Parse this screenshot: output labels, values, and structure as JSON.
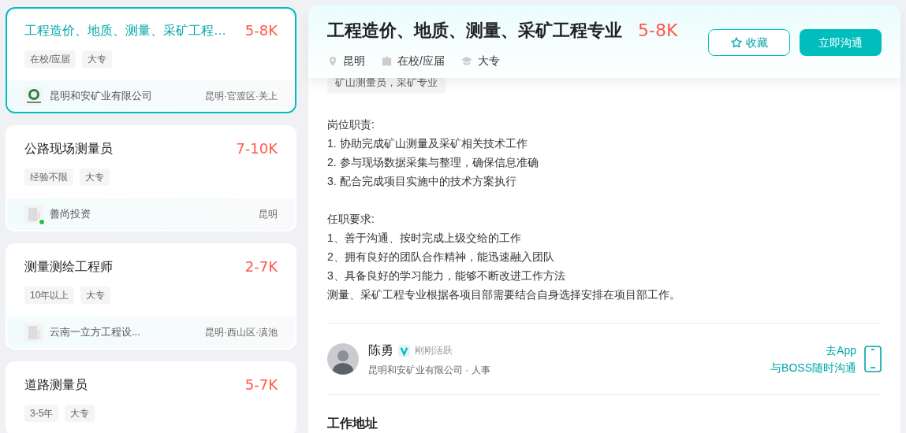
{
  "job_list": [
    {
      "title": "工程造价、地质、测量、采矿工程…",
      "salary": "5-8K",
      "tags": [
        "在校/应届",
        "大专"
      ],
      "company": "昆明和安矿业有限公司",
      "location": "昆明·官渡区·关上",
      "selected": true,
      "online": false,
      "logo": {
        "kind": "emblem"
      }
    },
    {
      "title": "公路现场测量员",
      "salary": "7-10K",
      "tags": [
        "经验不限",
        "大专"
      ],
      "company": "善尚投资",
      "location": "昆明",
      "selected": false,
      "online": true,
      "logo": {
        "kind": "building"
      }
    },
    {
      "title": "测量测绘工程师",
      "salary": "2-7K",
      "tags": [
        "10年以上",
        "大专"
      ],
      "company": "云南一立方工程设...",
      "location": "昆明·西山区·滇池",
      "selected": false,
      "online": false,
      "logo": {
        "kind": "building"
      }
    },
    {
      "title": "道路测量员",
      "salary": "5-7K",
      "tags": [
        "3-5年",
        "大专"
      ],
      "selected": false
    }
  ],
  "detail": {
    "title": "工程造价、地质、测量、采矿工程专业",
    "salary": "5-8K",
    "city": "昆明",
    "experience": "在校/应届",
    "degree": "大专",
    "favorite_button": "收藏",
    "chat_button": "立即沟通",
    "keyword_tag": "矿山测量员，采矿专业",
    "description": [
      [
        "岗位职责:",
        "1. 协助完成矿山测量及采矿相关技术工作",
        "2. 参与现场数据采集与整理，确保信息准确",
        "3. 配合完成项目实施中的技术方案执行"
      ],
      [
        "任职要求:",
        "1、善于沟通、按时完成上级交给的工作",
        "2、拥有良好的团队合作精神，能迅速融入团队",
        "3、具备良好的学习能力，能够不断改进工作方法",
        "测量、采矿工程专业根据各项目部需要结合自身选择安排在项目部工作。"
      ]
    ],
    "recruiter": {
      "name": "陈勇",
      "verified": true,
      "status": "刚刚活跃",
      "company_role": "昆明和安矿业有限公司 · 人事"
    },
    "app_promo": [
      "去App",
      "与BOSS随时沟通"
    ],
    "address_heading": "工作地址"
  }
}
